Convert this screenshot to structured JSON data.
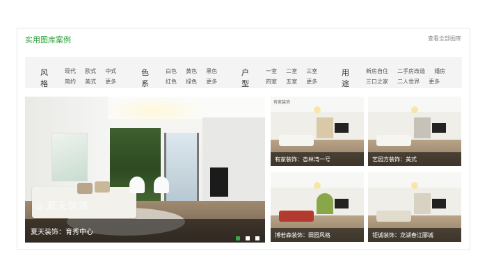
{
  "panel": {
    "title": "实用图库案例",
    "more_link": "查看全部图库",
    "accent_color": "#2fa23a"
  },
  "filters": [
    {
      "label": "风格",
      "rows": [
        [
          "现代",
          "欧式",
          "中式"
        ],
        [
          "简约",
          "美式",
          "更多"
        ]
      ]
    },
    {
      "label": "色系",
      "rows": [
        [
          "白色",
          "黄色",
          "黑色"
        ],
        [
          "红色",
          "绿色",
          "更多"
        ]
      ]
    },
    {
      "label": "户型",
      "rows": [
        [
          "一室",
          "二室",
          "三室"
        ],
        [
          "四室",
          "五室",
          "更多"
        ]
      ]
    },
    {
      "label": "用途",
      "rows": [
        [
          "新房自住",
          "二手房改造",
          "婚房"
        ],
        [
          "三口之家",
          "二人世界",
          "更多"
        ]
      ]
    }
  ],
  "hero": {
    "caption": "夏天装饰：育秀中心",
    "watermark": "夏天装饰",
    "slides": 3,
    "active_slide": 1
  },
  "thumbnails": [
    {
      "caption": "有家装饰：杏林湾一号",
      "logo": "有家装饰"
    },
    {
      "caption": "艺园方装饰：美式"
    },
    {
      "caption": "博若森装饰：田园风格"
    },
    {
      "caption": "钜诚装饰：龙湖春江郦城"
    }
  ]
}
